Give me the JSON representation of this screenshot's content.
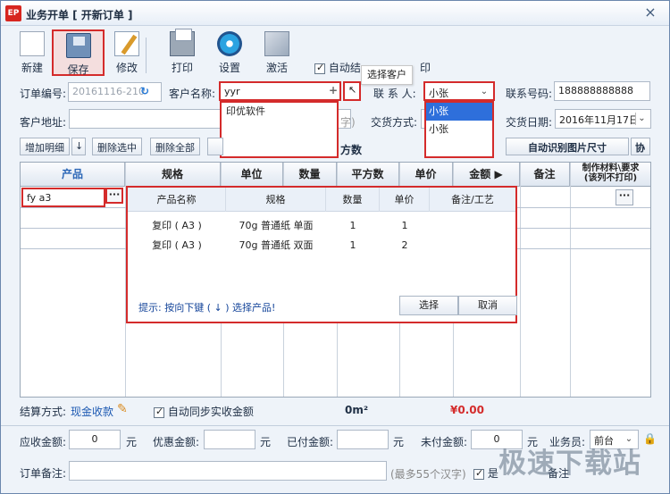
{
  "window": {
    "title": "业务开单 [ 开新订单 ]",
    "app_icon_text": "EP",
    "close_label": "×"
  },
  "toolbar": {
    "new": "新建",
    "save": "保存",
    "edit": "修改",
    "print": "打印",
    "settings": "设置",
    "activate": "激活",
    "auto_option": "自动结",
    "auto_option_tail": "印"
  },
  "tooltip": {
    "text": "选择客户"
  },
  "form": {
    "order_no_label": "订单编号:",
    "order_no": "20161116-210",
    "customer_name_label": "客户名称:",
    "customer_name": "yyr",
    "contact_label": "联 系 人:",
    "contact": "小张",
    "phone_label": "联系号码:",
    "phone": "188888888888",
    "address_label": "客户地址:",
    "address_hint": "字)",
    "delivery_method_label": "交货方式:",
    "delivery_date_label": "交货日期:",
    "delivery_date": "2016年11月17日"
  },
  "customer_dropdown": {
    "items": [
      "印优软件"
    ]
  },
  "contact_dropdown": {
    "items": [
      "小张",
      "小张"
    ],
    "selected_index": 0
  },
  "grid_toolbar": {
    "add_detail": "增加明细",
    "down_arrow": "↓",
    "delete_selected": "删除选中",
    "delete_all": "删除全部",
    "area_text": "方数",
    "auto_size": "自动识别图片尺寸",
    "cooperate": "协"
  },
  "grid": {
    "headers": [
      "产品",
      "规格",
      "单位",
      "数量",
      "平方数",
      "单价",
      "金额 ▶",
      "备注",
      "制作材料\\要求\n(该列不打印)"
    ],
    "row1_product": "fy a3",
    "ellipsis": "···"
  },
  "product_popup": {
    "headers": [
      "产品名称",
      "规格",
      "数量",
      "单价",
      "备注/工艺"
    ],
    "rows": [
      {
        "name": "复印 ( A3 )",
        "spec": "70g 普通纸 单面",
        "qty": "1",
        "price": "1",
        "note": ""
      },
      {
        "name": "复印 ( A3 )",
        "spec": "70g 普通纸 双面",
        "qty": "1",
        "price": "2",
        "note": ""
      }
    ],
    "hint": "提示: 按向下键 ( ↓ ) 选择产品!",
    "select_button": "选择",
    "cancel_button": "取消"
  },
  "summary": {
    "settlement_label": "结算方式:",
    "settlement_value": "现金收款",
    "sync_label": "自动同步实收金额",
    "area_total": "0m²",
    "total_amount": "¥0.00"
  },
  "amounts": {
    "receivable_label": "应收金额:",
    "receivable": "0",
    "discount_label": "优惠金额:",
    "discount": "",
    "paid_label": "已付金额:",
    "paid": "",
    "unpaid_label": "未付金额:",
    "unpaid": "0",
    "unit": "元",
    "salesperson_label": "业务员:",
    "salesperson": "前台"
  },
  "notes": {
    "label": "订单备注:",
    "hint": "(最多55个汉字)",
    "checkbox_label": "是",
    "checkbox_tail": "备注"
  },
  "watermark": {
    "text": "极速下载站"
  }
}
